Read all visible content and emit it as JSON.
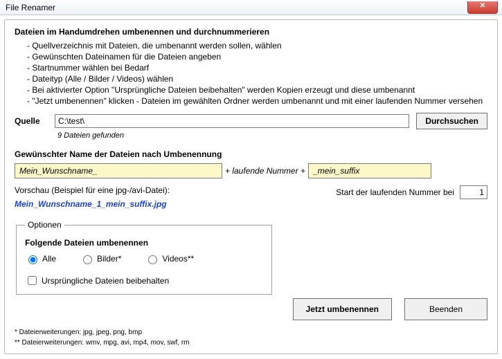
{
  "window": {
    "title": "File Renamer",
    "close_glyph": "✕"
  },
  "instructions": {
    "heading": "Dateien im Handumdrehen umbenennen und durchnummerieren",
    "items": [
      "Quellverzeichnis mit Dateien, die umbenannt werden sollen, wählen",
      "Gewünschten Dateinamen für die Dateien angeben",
      "Startnummer wählen bei Bedarf",
      "Dateityp (Alle / Bilder / Videos) wählen",
      "Bei aktivierter Option \"Ursprüngliche Dateien beibehalten\" werden Kopien erzeugt und diese umbenannt",
      "\"Jetzt umbenennen\" klicken - Dateien im gewählten Ordner werden umbenannt und mit einer laufenden Nummer versehen"
    ]
  },
  "source": {
    "label": "Quelle",
    "path": "C:\\test\\",
    "browse": "Durchsuchen",
    "found": "9 Dateien gefunden"
  },
  "naming": {
    "heading": "Gewünschter Name der Dateien nach Umbenennung",
    "prefix": "Mein_Wunschname_",
    "join_text": "+ laufende Nummer +",
    "suffix": "_mein_suffix",
    "preview_label": "Vorschau (Beispiel für eine jpg-/avi-Datei):",
    "preview_value": "Mein_Wunschname_1_mein_suffix.jpg",
    "start_label": "Start der laufenden Nummer bei",
    "start_value": "1"
  },
  "options": {
    "legend": "Optionen",
    "subheading": "Folgende Dateien umbenennen",
    "radio_all": "Alle",
    "radio_images": "Bilder*",
    "radio_videos": "Videos**",
    "keep_original": "Ursprüngliche Dateien beibehalten"
  },
  "actions": {
    "rename": "Jetzt umbenennen",
    "close": "Beenden"
  },
  "footnotes": {
    "images": "* Dateierweiterungen: jpg, jpeg, png, bmp",
    "videos": "** Dateierweiterungen: wmv, mpg, avi, mp4, mov, swf, rm"
  }
}
